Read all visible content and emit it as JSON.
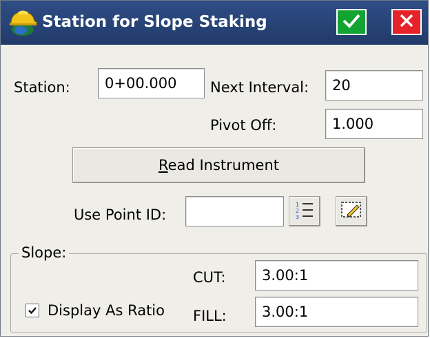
{
  "window": {
    "title": "Station for Slope Staking",
    "ok_icon": "checkmark-icon",
    "close_icon": "close-icon"
  },
  "station": {
    "label": "Station:",
    "value": "0+00.000"
  },
  "next_interval": {
    "label": "Next Interval:",
    "value": "20"
  },
  "pivot_off": {
    "label": "Pivot Off:",
    "value": "1.000"
  },
  "read_instrument": {
    "label_prefix": "R",
    "label_rest": "ead Instrument"
  },
  "use_point_id": {
    "label": "Use Point ID:",
    "value": "",
    "list_icon": "numbered-list-icon",
    "map_icon": "map-select-icon"
  },
  "slope": {
    "title": "Slope:",
    "display_as_ratio": {
      "label": "Display As Ratio",
      "checked": true
    },
    "cut": {
      "label": "CUT:",
      "value": "3.00:1"
    },
    "fill": {
      "label": "FILL:",
      "value": "3.00:1"
    }
  },
  "colors": {
    "titlebar": "#2f4e86",
    "ok": "#13a333",
    "close": "#e6222a",
    "background": "#efeee9"
  }
}
